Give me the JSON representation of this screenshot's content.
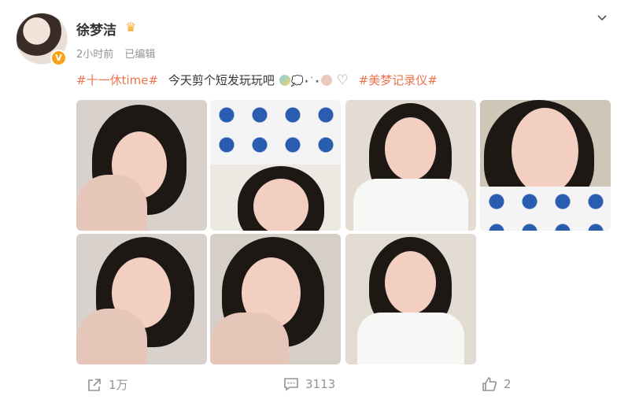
{
  "post": {
    "author": "徐梦洁",
    "time": "2小时前",
    "edited": "已编辑",
    "hashtag1": "#十一休time#",
    "body_text": "今天剪个短发玩玩吧",
    "emoji_text": "💭",
    "stars": "⋆˙⋆",
    "heart": "♡",
    "hashtag2": "#美梦记录仪#"
  },
  "icons": {
    "verified": "v-badge-icon",
    "crown": "crown-icon",
    "more": "chevron-down-icon",
    "share": "share-icon",
    "comment": "comment-icon",
    "like": "like-icon"
  },
  "footer": {
    "share_count": "1万",
    "comment_count": "3113",
    "like_count": "2"
  },
  "colors": {
    "accent": "#eb7350",
    "meta": "#939393",
    "badge": "#f7a21b"
  }
}
